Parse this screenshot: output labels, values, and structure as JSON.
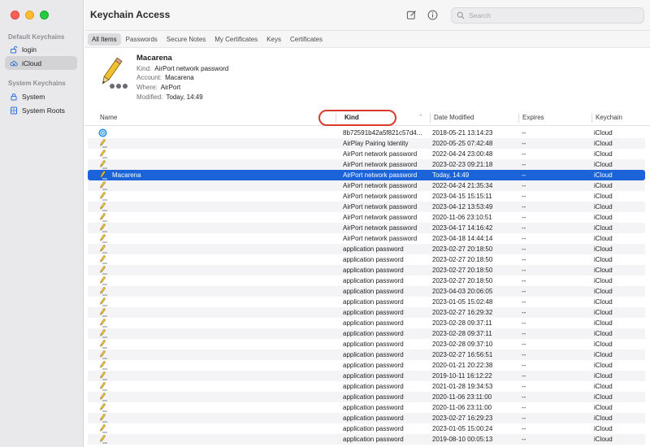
{
  "window": {
    "traffic": [
      "close",
      "minimize",
      "zoom"
    ]
  },
  "sidebar": {
    "default_header": "Default Keychains",
    "default_items": [
      {
        "label": "login",
        "icon": "unlock-icon",
        "active": false
      },
      {
        "label": "iCloud",
        "icon": "cloud-icon",
        "active": true
      }
    ],
    "system_header": "System Keychains",
    "system_items": [
      {
        "label": "System",
        "icon": "lock-icon"
      },
      {
        "label": "System Roots",
        "icon": "cabinet-icon"
      }
    ]
  },
  "toolbar": {
    "title": "Keychain Access",
    "search_placeholder": "Search",
    "icons": [
      "compose-icon",
      "info-icon",
      "search-icon"
    ]
  },
  "tabs": [
    "All Items",
    "Passwords",
    "Secure Notes",
    "My Certificates",
    "Keys",
    "Certificates"
  ],
  "details": {
    "name": "Macarena",
    "kind_label": "Kind:",
    "kind": "AirPort network password",
    "account_label": "Account:",
    "account": "Macarena",
    "where_label": "Where:",
    "where": "AirPort",
    "modified_label": "Modified:",
    "modified": "Today, 14:49"
  },
  "columns": {
    "name": "Name",
    "kind": "Kind",
    "date": "Date Modified",
    "expires": "Expires",
    "keychain": "Keychain"
  },
  "rows": [
    {
      "icon": "at-icon",
      "name": "",
      "kind": "8b72591b42a5f821c57d4...",
      "date": "2018-05-21 13:14:23",
      "expires": "--",
      "keychain": "iCloud"
    },
    {
      "icon": "key-pencil-icon",
      "name": "",
      "kind": "AirPlay Pairing Identity",
      "date": "2020-05-25 07:42:48",
      "expires": "--",
      "keychain": "iCloud"
    },
    {
      "icon": "key-pencil-icon",
      "name": "",
      "kind": "AirPort network password",
      "date": "2022-04-24 23:00:48",
      "expires": "--",
      "keychain": "iCloud"
    },
    {
      "icon": "key-pencil-icon",
      "name": "",
      "kind": "AirPort network password",
      "date": "2023-02-23 09:21:18",
      "expires": "--",
      "keychain": "iCloud"
    },
    {
      "icon": "key-pencil-icon",
      "name": "Macarena",
      "kind": "AirPort network password",
      "date": "Today, 14:49",
      "expires": "--",
      "keychain": "iCloud",
      "selected": true
    },
    {
      "icon": "key-pencil-icon",
      "name": "",
      "kind": "AirPort network password",
      "date": "2022-04-24 21:35:34",
      "expires": "--",
      "keychain": "iCloud"
    },
    {
      "icon": "key-pencil-icon",
      "name": "",
      "kind": "AirPort network password",
      "date": "2023-04-15 15:15:11",
      "expires": "--",
      "keychain": "iCloud"
    },
    {
      "icon": "key-pencil-icon",
      "name": "",
      "kind": "AirPort network password",
      "date": "2023-04-12 13:53:49",
      "expires": "--",
      "keychain": "iCloud"
    },
    {
      "icon": "key-pencil-icon",
      "name": "",
      "kind": "AirPort network password",
      "date": "2020-11-06 23:10:51",
      "expires": "--",
      "keychain": "iCloud"
    },
    {
      "icon": "key-pencil-icon",
      "name": "",
      "kind": "AirPort network password",
      "date": "2023-04-17 14:16:42",
      "expires": "--",
      "keychain": "iCloud"
    },
    {
      "icon": "key-pencil-icon",
      "name": "",
      "kind": "AirPort network password",
      "date": "2023-04-18 14:44:14",
      "expires": "--",
      "keychain": "iCloud"
    },
    {
      "icon": "key-pencil-icon",
      "name": "",
      "kind": "application password",
      "date": "2023-02-27 20:18:50",
      "expires": "--",
      "keychain": "iCloud"
    },
    {
      "icon": "key-pencil-icon",
      "name": "",
      "kind": "application password",
      "date": "2023-02-27 20:18:50",
      "expires": "--",
      "keychain": "iCloud"
    },
    {
      "icon": "key-pencil-icon",
      "name": "",
      "kind": "application password",
      "date": "2023-02-27 20:18:50",
      "expires": "--",
      "keychain": "iCloud"
    },
    {
      "icon": "key-pencil-icon",
      "name": "",
      "kind": "application password",
      "date": "2023-02-27 20:18:50",
      "expires": "--",
      "keychain": "iCloud"
    },
    {
      "icon": "key-pencil-icon",
      "name": "",
      "kind": "application password",
      "date": "2023-04-03 20:06:05",
      "expires": "--",
      "keychain": "iCloud"
    },
    {
      "icon": "key-pencil-icon",
      "name": "",
      "kind": "application password",
      "date": "2023-01-05 15:02:48",
      "expires": "--",
      "keychain": "iCloud"
    },
    {
      "icon": "key-pencil-icon",
      "name": "",
      "kind": "application password",
      "date": "2023-02-27 16:29:32",
      "expires": "--",
      "keychain": "iCloud"
    },
    {
      "icon": "key-pencil-icon",
      "name": "",
      "kind": "application password",
      "date": "2023-02-28 09:37:11",
      "expires": "--",
      "keychain": "iCloud"
    },
    {
      "icon": "key-pencil-icon",
      "name": "",
      "kind": "application password",
      "date": "2023-02-28 09:37:11",
      "expires": "--",
      "keychain": "iCloud"
    },
    {
      "icon": "key-pencil-icon",
      "name": "",
      "kind": "application password",
      "date": "2023-02-28 09:37:10",
      "expires": "--",
      "keychain": "iCloud"
    },
    {
      "icon": "key-pencil-icon",
      "name": "",
      "kind": "application password",
      "date": "2023-02-27 16:56:51",
      "expires": "--",
      "keychain": "iCloud"
    },
    {
      "icon": "key-pencil-icon",
      "name": "",
      "kind": "application password",
      "date": "2020-01-21 20:22:38",
      "expires": "--",
      "keychain": "iCloud"
    },
    {
      "icon": "key-pencil-icon",
      "name": "",
      "kind": "application password",
      "date": "2019-10-11 16:12:22",
      "expires": "--",
      "keychain": "iCloud"
    },
    {
      "icon": "key-pencil-icon",
      "name": "",
      "kind": "application password",
      "date": "2021-01-28 19:34:53",
      "expires": "--",
      "keychain": "iCloud"
    },
    {
      "icon": "key-pencil-icon",
      "name": "",
      "kind": "application password",
      "date": "2020-11-06 23:11:00",
      "expires": "--",
      "keychain": "iCloud"
    },
    {
      "icon": "key-pencil-icon",
      "name": "",
      "kind": "application password",
      "date": "2020-11-06 23:11:00",
      "expires": "--",
      "keychain": "iCloud"
    },
    {
      "icon": "key-pencil-icon",
      "name": "",
      "kind": "application password",
      "date": "2023-02-27 16:29:23",
      "expires": "--",
      "keychain": "iCloud"
    },
    {
      "icon": "key-pencil-icon",
      "name": "",
      "kind": "application password",
      "date": "2023-01-05 15:00:24",
      "expires": "--",
      "keychain": "iCloud"
    },
    {
      "icon": "key-pencil-icon",
      "name": "",
      "kind": "application password",
      "date": "2019-08-10 00:05:13",
      "expires": "--",
      "keychain": "iCloud"
    }
  ],
  "colors": {
    "selection": "#1b63d8",
    "annotation_ring": "#d93a2f"
  }
}
